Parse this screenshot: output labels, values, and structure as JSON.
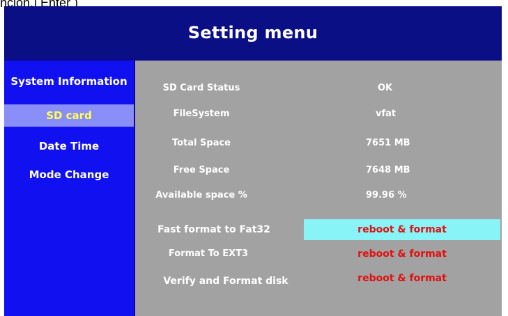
{
  "top_fragment": "ñcion,] Enter )",
  "header": {
    "title": "Setting menu"
  },
  "sidebar": {
    "items": [
      {
        "label": "System Information",
        "active": false
      },
      {
        "label": "SD card",
        "active": true
      },
      {
        "label": "Date Time",
        "active": false
      },
      {
        "label": "Mode Change",
        "active": false
      }
    ]
  },
  "sd_card": {
    "status_label": "SD Card Status",
    "status_value": "OK",
    "filesystem_label": "FileSystem",
    "filesystem_value": "vfat",
    "total_label": "Total Space",
    "total_value": "7651 MB",
    "free_label": "Free Space",
    "free_value": "7648 MB",
    "available_label": "Available space %",
    "available_value": "99.96 %",
    "fast_format_label": "Fast format to Fat32",
    "fast_format_action": "reboot & format",
    "ext3_label": "Format To EXT3",
    "ext3_action": "reboot & format",
    "verify_label": "Verify and Format disk",
    "verify_action": "reboot & format"
  },
  "colors": {
    "header_bg": "#0a0f86",
    "sidebar_bg": "#1010f0",
    "sidebar_active_bg": "#8a8ef8",
    "sidebar_active_text": "#ffff55",
    "content_bg": "#a2a2a2",
    "action_text": "#e01010",
    "action_highlight_bg": "#88f4f8"
  }
}
